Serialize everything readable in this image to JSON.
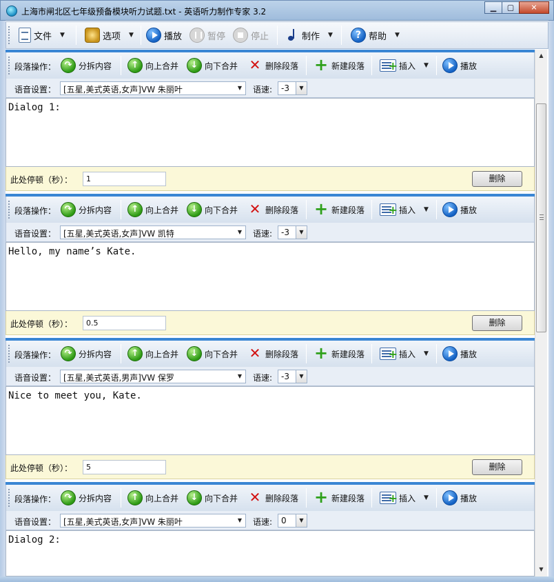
{
  "window": {
    "title": "上海市闸北区七年级预备模块听力试题.txt - 英语听力制作专家 3.2",
    "min_icon": "minimize-icon",
    "max_icon": "maximize-icon",
    "close_icon": "close-icon"
  },
  "toolbar": {
    "file": "文件",
    "options": "选项",
    "play": "播放",
    "pause": "暂停",
    "stop": "停止",
    "make": "制作",
    "help": "帮助"
  },
  "paragraph_labels": {
    "ops": "段落操作：",
    "split": "分拆内容",
    "merge_up": "向上合并",
    "merge_down": "向下合并",
    "delete_para": "删除段落",
    "new_para": "新建段落",
    "insert": "插入",
    "play": "播放",
    "voice": "语音设置：",
    "speed": "语速:",
    "pause": "此处停顿（秒）：",
    "delete": "删除"
  },
  "paragraphs": [
    {
      "voice": "[五星,美式英语,女声]VW 朱丽叶",
      "speed": "-3",
      "text": "Dialog 1:",
      "pause": "1"
    },
    {
      "voice": "[五星,美式英语,女声]VW 凯特",
      "speed": "-3",
      "text": "Hello, my name’s Kate.",
      "pause": "0.5"
    },
    {
      "voice": "[五星,美式英语,男声]VW 保罗",
      "speed": "-3",
      "text": "Nice to meet you, Kate.",
      "pause": "5"
    },
    {
      "voice": "[五星,美式英语,女声]VW 朱丽叶",
      "speed": "0",
      "text": "Dialog 2:"
    }
  ],
  "colors": {
    "accent_bar": "#3a86d4",
    "pause_row_bg": "#fbf8d8",
    "delete_x": "#d21010",
    "add_plus": "#2ea01a"
  }
}
